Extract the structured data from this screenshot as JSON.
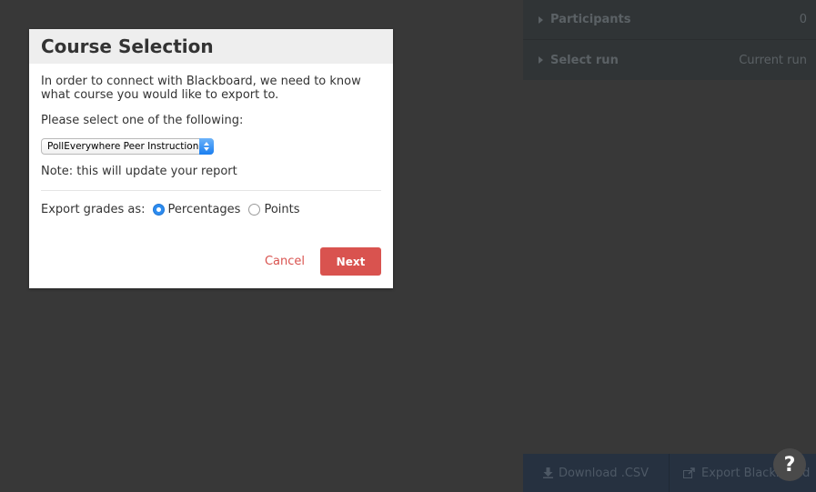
{
  "side_panel": {
    "rows": [
      {
        "label": "Participants",
        "value": "0"
      },
      {
        "label": "Select run",
        "value": "Current run"
      }
    ]
  },
  "bottom_bar": {
    "download_label": "Download .CSV",
    "export_label": "Export Blackboard"
  },
  "help": {
    "label": "?"
  },
  "modal": {
    "title": "Course Selection",
    "intro": "In order to connect with Blackboard, we need to know what course you would like to export to.",
    "prompt": "Please select one of the following:",
    "course_select": {
      "selected": "PollEverywhere Peer Instruction"
    },
    "note": "Note: this will update your report",
    "export": {
      "label": "Export grades as:",
      "options": [
        {
          "label": "Percentages",
          "selected": true
        },
        {
          "label": "Points",
          "selected": false
        }
      ]
    },
    "cancel_label": "Cancel",
    "next_label": "Next"
  },
  "colors": {
    "overlay": "#383838",
    "accent_red": "#d9534f",
    "radio_blue": "#2d8cf0",
    "bottom_bar": "#263140"
  }
}
